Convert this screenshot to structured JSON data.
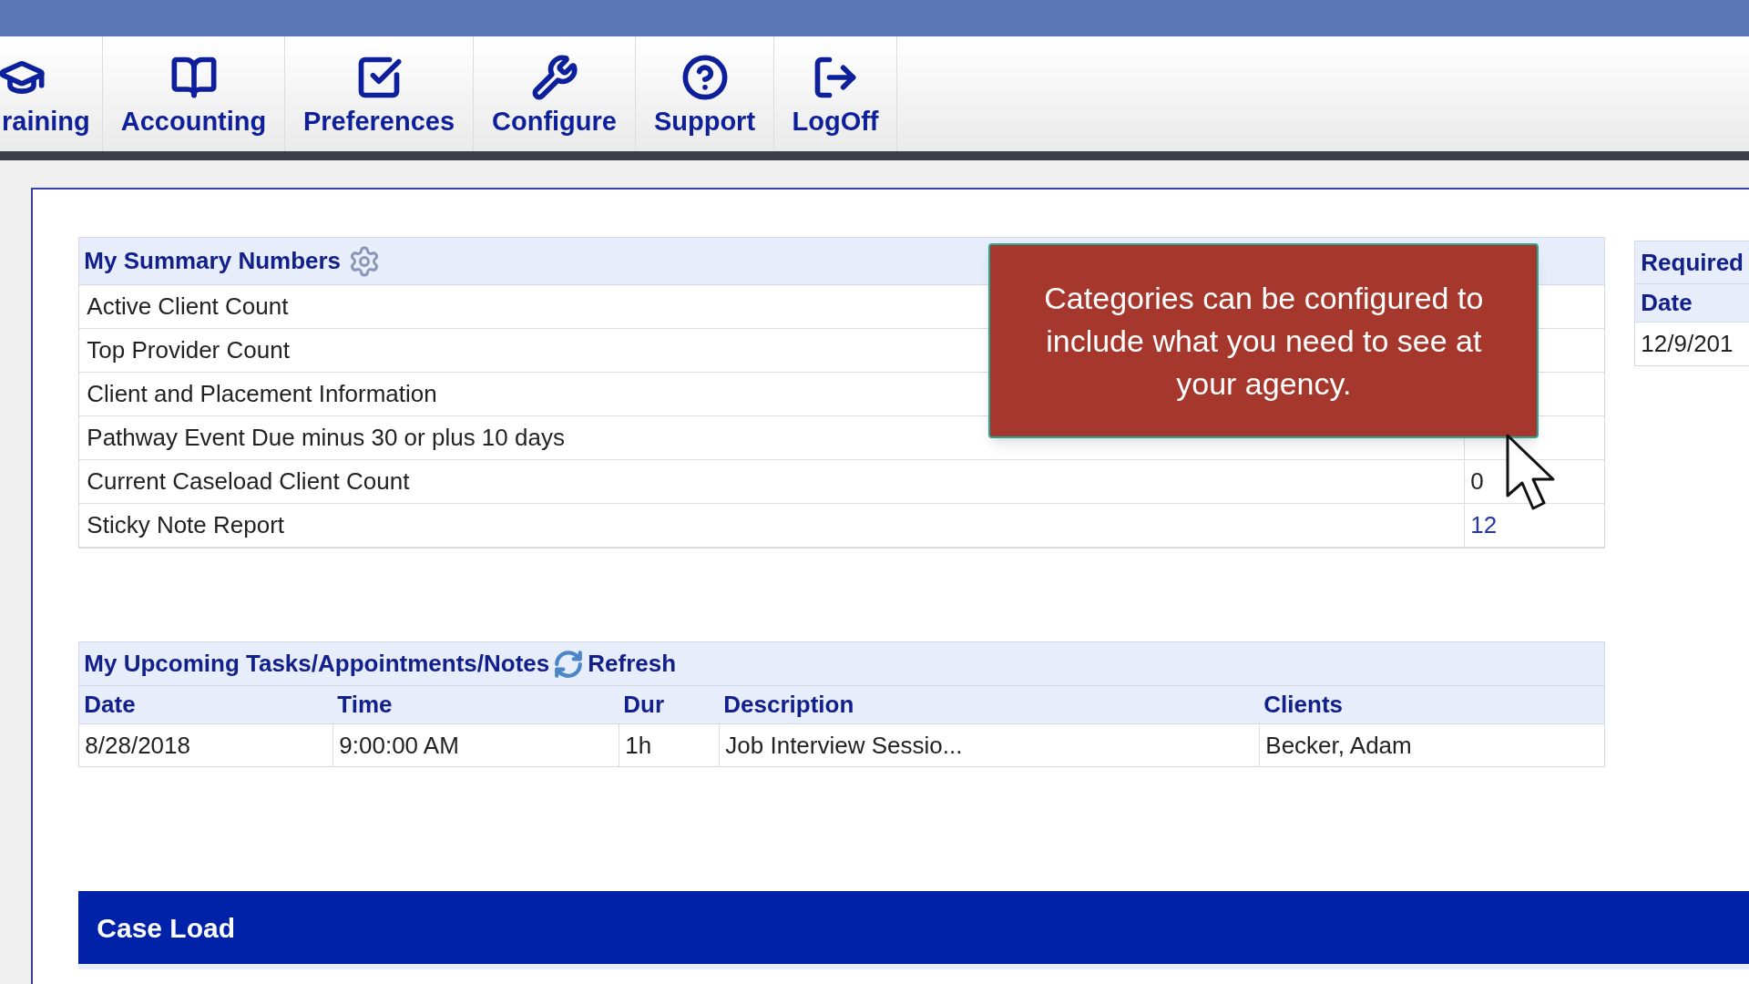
{
  "nav": [
    {
      "label": "raining"
    },
    {
      "label": "Accounting"
    },
    {
      "label": "Preferences"
    },
    {
      "label": "Configure"
    },
    {
      "label": "Support"
    },
    {
      "label": "LogOff"
    }
  ],
  "summary": {
    "title": "My Summary Numbers",
    "rows": [
      {
        "label": "Active Client Count"
      },
      {
        "label": "Top Provider Count"
      },
      {
        "label": "Client and Placement Information"
      },
      {
        "label": "Pathway Event Due minus 30 or plus 10 days"
      },
      {
        "label": "Current Caseload Client Count",
        "value": "0",
        "link": false
      },
      {
        "label": "Sticky Note Report",
        "value": "12",
        "link": true
      }
    ]
  },
  "tooltip": {
    "text": "Categories can be configured to include what you need to see at your agency."
  },
  "required": {
    "title": "Required",
    "columns": [
      "Date"
    ],
    "rows": [
      [
        "12/9/201"
      ]
    ]
  },
  "tasks": {
    "title": "My Upcoming Tasks/Appointments/Notes",
    "refresh": "Refresh",
    "columns": [
      "Date",
      "Time",
      "Dur",
      "Description",
      "Clients"
    ],
    "rows": [
      [
        "8/28/2018",
        "9:00:00 AM",
        "1h",
        "Job Interview Sessio...",
        "Becker, Adam"
      ]
    ]
  },
  "caseload": {
    "title": "Case Load"
  }
}
